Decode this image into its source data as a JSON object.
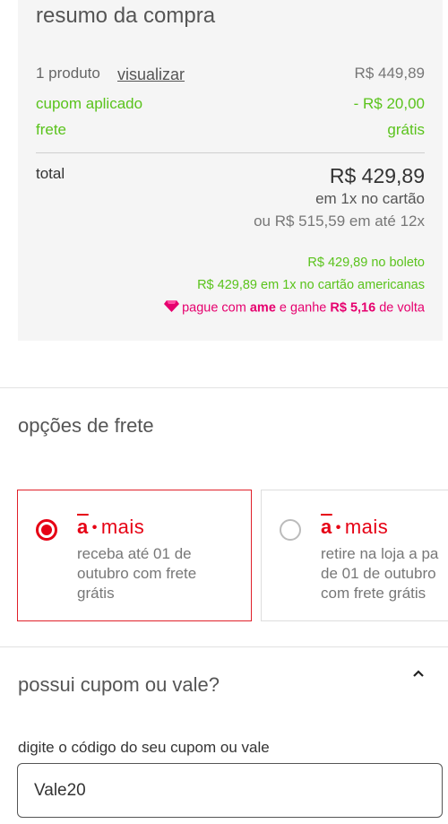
{
  "summary": {
    "title": "resumo da compra",
    "product_count": "1 produto",
    "view_link": "visualizar",
    "product_price": "R$ 449,89",
    "coupon_label": "cupom aplicado",
    "coupon_value": "- R$ 20,00",
    "shipping_label": "frete",
    "shipping_value": "grátis",
    "total_label": "total",
    "total_value": "R$ 429,89",
    "total_sub": "em 1x no cartão",
    "installments": "ou R$ 515,59 em até 12x",
    "boleto_price": "R$ 429,89",
    "boleto_text": " no boleto",
    "card_price": "R$ 429,89",
    "card_mid": " em ",
    "card_times": "1x",
    "card_text": " no cartão americanas",
    "ame_prefix": "pague com ",
    "ame_brand": "ame",
    "ame_mid": " e ganhe ",
    "ame_cashback": "R$ 5,16",
    "ame_suffix": " de volta"
  },
  "shipping_options": {
    "title": "opções de frete",
    "options": [
      {
        "logo_a": "a",
        "logo_mais": "mais",
        "line1": "receba até 01 de",
        "line2": "outubro com frete",
        "line3": "grátis",
        "selected": true
      },
      {
        "logo_a": "a",
        "logo_mais": "mais",
        "line1": "retire na loja a pa",
        "line2": "de 01 de outubro",
        "line3": "com frete grátis",
        "selected": false
      }
    ]
  },
  "coupon": {
    "title": "possui cupom ou vale?",
    "field_label": "digite o código do seu cupom ou vale",
    "field_value": "Vale20"
  },
  "colors": {
    "accent_red": "#e60014",
    "green": "#5ac31c",
    "ame_pink": "#e6006e"
  }
}
